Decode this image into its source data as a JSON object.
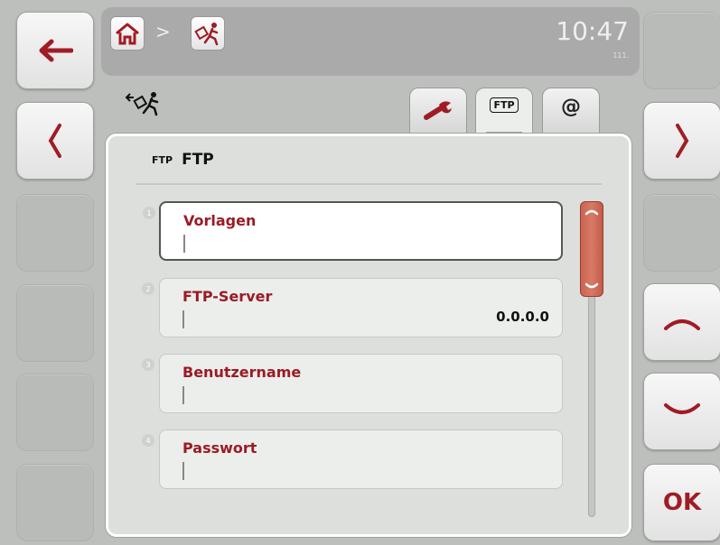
{
  "header": {
    "breadcrumb_separator": ">",
    "clock": "10:47",
    "clock_sub": "111."
  },
  "tabs": [
    {
      "name": "settings",
      "icon": "wrench-icon"
    },
    {
      "name": "ftp",
      "icon": "ftp-icon",
      "label": "FTP",
      "active": true
    },
    {
      "name": "email",
      "icon": "at-icon",
      "label": "@"
    }
  ],
  "panel": {
    "title_icon_label": "FTP",
    "title": "FTP"
  },
  "fields": [
    {
      "index": "1",
      "label": "Vorlagen",
      "value": "",
      "selected": true
    },
    {
      "index": "2",
      "label": "FTP-Server",
      "value": "0.0.0.0"
    },
    {
      "index": "3",
      "label": "Benutzername",
      "value": ""
    },
    {
      "index": "4",
      "label": "Passwort",
      "value": ""
    }
  ],
  "softkeys": {
    "ok_label": "OK"
  },
  "colors": {
    "accent": "#9a1b25",
    "scroll_thumb": "#d06e5b",
    "background": "#bdbfbd"
  }
}
